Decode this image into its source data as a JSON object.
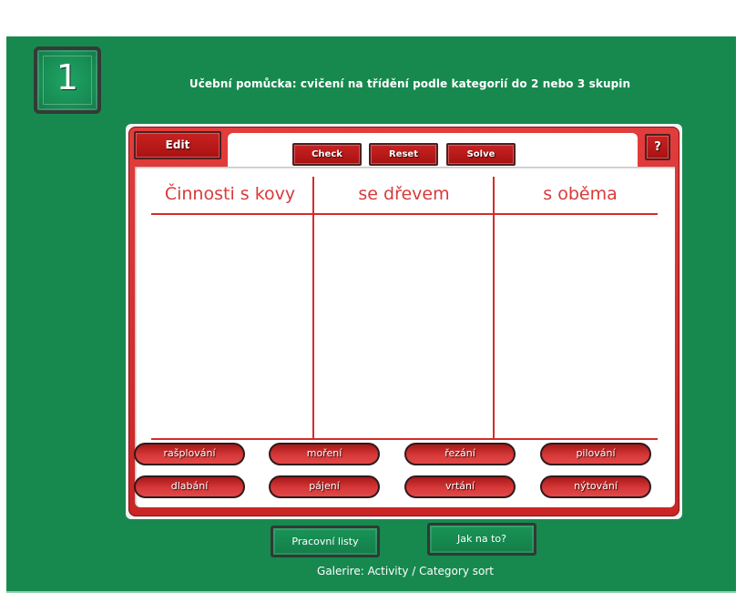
{
  "header": {
    "slide_number": "1",
    "title": "Učební pomůcka: cvičení na třídění podle kategorií do 2 nebo 3 skupin"
  },
  "toolbar": {
    "edit_label": "Edit",
    "check_label": "Check",
    "reset_label": "Reset",
    "solve_label": "Solve",
    "help_label": "?"
  },
  "categories": [
    {
      "label": "Činnosti s kovy"
    },
    {
      "label": "se dřevem"
    },
    {
      "label": "s oběma"
    }
  ],
  "cards": [
    {
      "label": "rašplování"
    },
    {
      "label": "moření"
    },
    {
      "label": "řezání"
    },
    {
      "label": "pilování"
    },
    {
      "label": "dlabání"
    },
    {
      "label": "pájení"
    },
    {
      "label": "vrtání"
    },
    {
      "label": "nýtování"
    }
  ],
  "footer_buttons": {
    "worksheets_label": "Pracovní listy",
    "howto_label": "Jak na to?"
  },
  "footer": {
    "caption": "Galerire: Activity / Category sort"
  },
  "colors": {
    "background_green": "#17894f",
    "accent_red": "#c92525",
    "heading_red": "#d93a3a"
  }
}
